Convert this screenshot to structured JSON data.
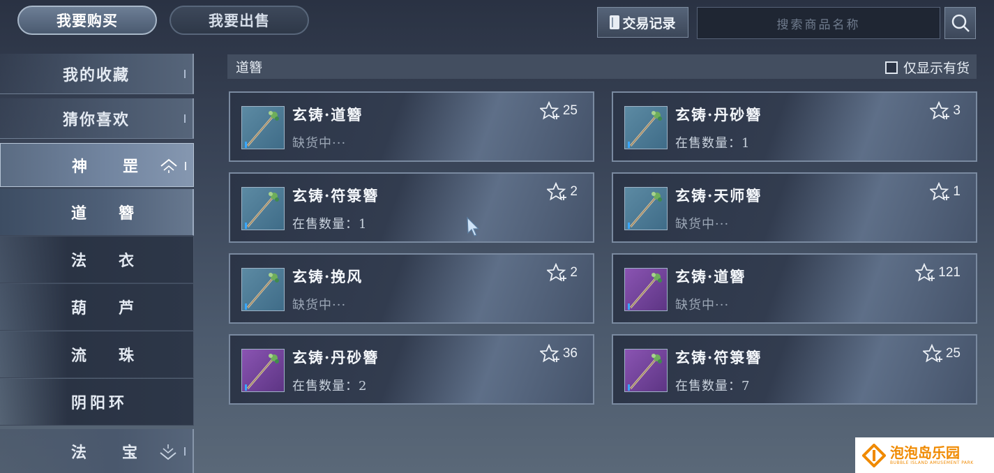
{
  "tabs": {
    "buy": "我要购买",
    "sell": "我要出售"
  },
  "toolbar": {
    "trade_record": "交易记录",
    "search_placeholder": "搜索商品名称"
  },
  "sidebar": {
    "favorites": "我的收藏",
    "recommend": "猜你喜欢",
    "expanded": {
      "a": "神",
      "b": "罡"
    },
    "items": [
      {
        "a": "道",
        "b": "簪"
      },
      {
        "a": "法",
        "b": "衣"
      },
      {
        "a": "葫",
        "b": "芦"
      },
      {
        "a": "流",
        "b": "珠"
      },
      {
        "label": "阴阳环"
      }
    ],
    "bottom": {
      "a": "法",
      "b": "宝"
    }
  },
  "category_bar": {
    "title": "道簪",
    "filter_label": "仅显示有货",
    "filter_checked": false
  },
  "items": [
    {
      "name": "玄铸·道簪",
      "status": "缺货中···",
      "favorites": "25",
      "rarity": "blue"
    },
    {
      "name": "玄铸·丹砂簪",
      "status": "在售数量：1",
      "favorites": "3",
      "rarity": "blue"
    },
    {
      "name": "玄铸·符箓簪",
      "status": "在售数量：1",
      "favorites": "2",
      "rarity": "blue"
    },
    {
      "name": "玄铸·天师簪",
      "status": "缺货中···",
      "favorites": "1",
      "rarity": "blue"
    },
    {
      "name": "玄铸·挽风",
      "status": "缺货中···",
      "favorites": "2",
      "rarity": "blue"
    },
    {
      "name": "玄铸·道簪",
      "status": "缺货中···",
      "favorites": "121",
      "rarity": "purple"
    },
    {
      "name": "玄铸·丹砂簪",
      "status": "在售数量：2",
      "favorites": "36",
      "rarity": "purple"
    },
    {
      "name": "玄铸·符箓簪",
      "status": "在售数量：7",
      "favorites": "25",
      "rarity": "purple"
    }
  ],
  "watermark": {
    "main": "泡泡岛乐园",
    "sub": "BUBBLE ISLAND AMUSEMENT PARK"
  },
  "colors": {
    "blue_rarity": "#4f7c96",
    "purple_rarity": "#7a47a3",
    "watermark": "#f08a00"
  }
}
